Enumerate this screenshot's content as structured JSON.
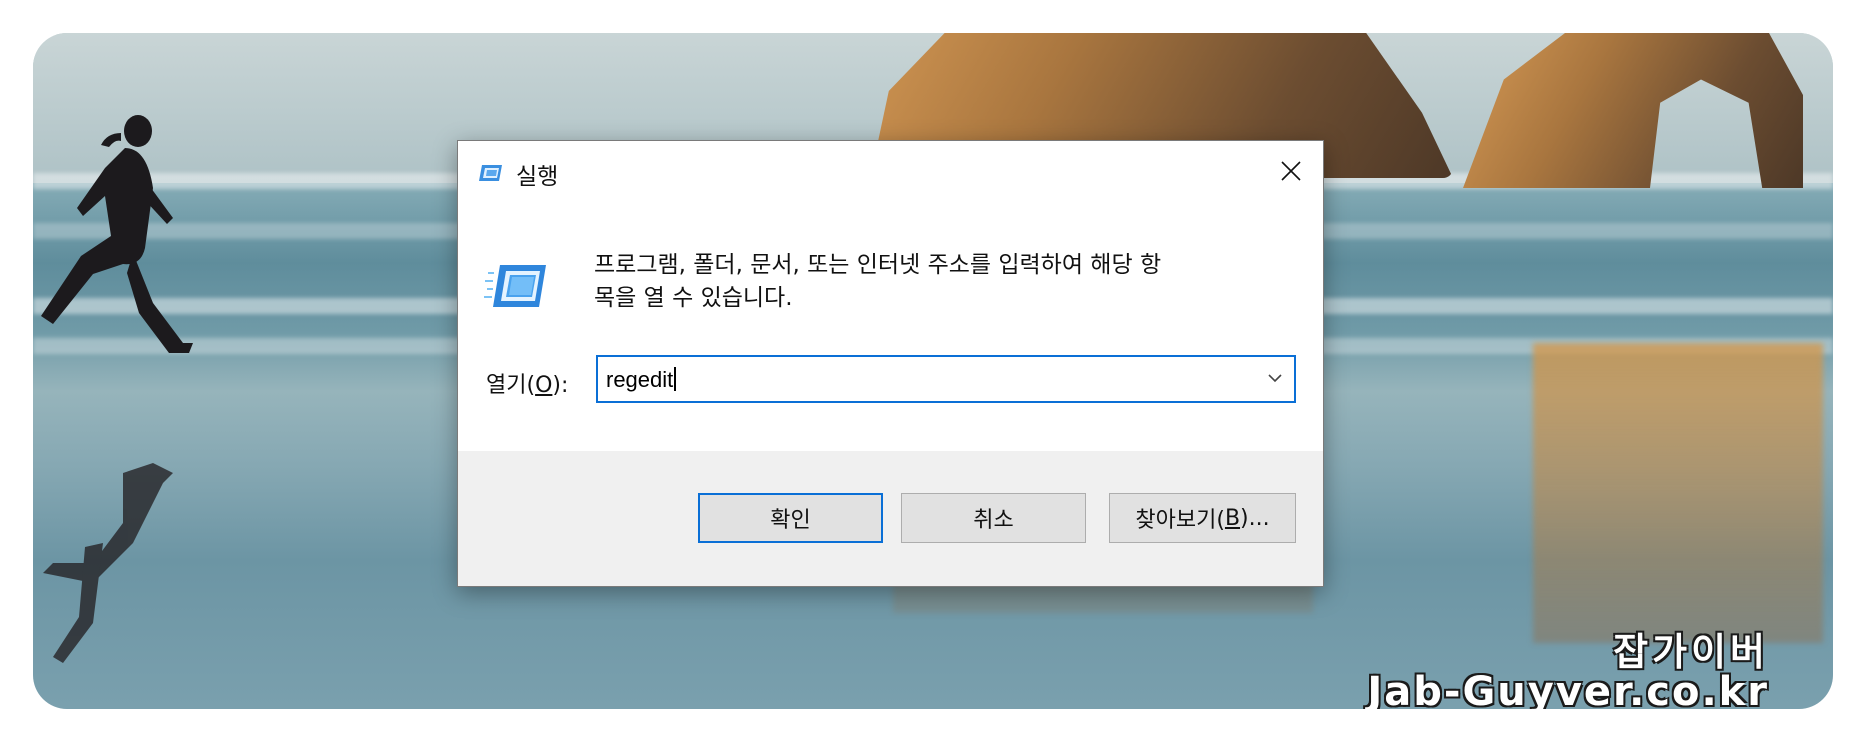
{
  "dialog": {
    "title": "실행",
    "description_line1": "프로그램, 폴더, 문서, 또는 인터넷 주소를 입력하여 해당 항",
    "description_line2": "목을 열 수 있습니다.",
    "open_label_prefix": "열기(",
    "open_label_key": "O",
    "open_label_suffix": "):",
    "input_value": "regedit",
    "ok_label": "확인",
    "cancel_label": "취소",
    "browse_label_prefix": "찾아보기(",
    "browse_label_key": "B",
    "browse_label_suffix": ")...",
    "icons": {
      "title": "run-icon",
      "large": "run-icon",
      "close": "close-icon",
      "dropdown": "chevron-down-icon"
    }
  },
  "watermark": {
    "korean": "잡가이버",
    "domain": "Jab-Guyver.co.kr"
  },
  "colors": {
    "accent": "#0a6fd6",
    "footer_bg": "#f0f0f0",
    "button_bg": "#e1e1e1"
  }
}
